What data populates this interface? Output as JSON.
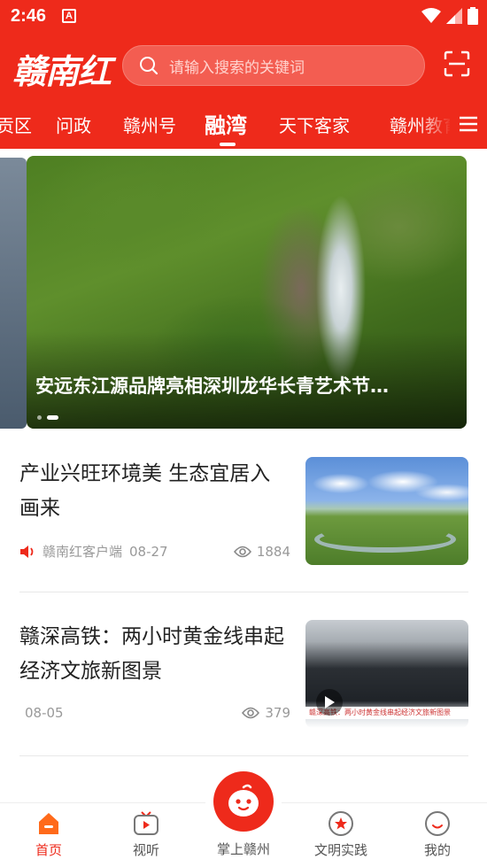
{
  "status_bar": {
    "time": "2:46",
    "notification_letter": "A"
  },
  "header": {
    "logo_text": "赣南红",
    "search_placeholder": "请输入搜索的关键词",
    "scan_icon": "scan-icon"
  },
  "tabs": {
    "items": [
      "贡区",
      "问政",
      "赣州号",
      "融湾",
      "天下客家",
      "赣州教育"
    ],
    "active": "融湾"
  },
  "banner": {
    "title": "安远东江源品牌亮相深圳龙华长青艺术节…",
    "slide_count": 2,
    "active_slide": 2
  },
  "news": [
    {
      "title": "产业兴旺环境美  生态宜居入画来",
      "source": "赣南红客户端",
      "date": "08-27",
      "views": "1884",
      "has_audio_icon": true,
      "is_video": false
    },
    {
      "title": "赣深高铁：两小时黄金线串起经济文旅新图景",
      "source": "",
      "date": "08-05",
      "views": "379",
      "has_audio_icon": false,
      "is_video": true,
      "thumb_caption": "赣深高铁：两小时黄金线串起经济文旅新图景"
    }
  ],
  "bottom_nav": {
    "items": [
      {
        "label": "首页",
        "icon": "home-icon",
        "active": true
      },
      {
        "label": "视听",
        "icon": "tv-icon",
        "active": false
      },
      {
        "label": "掌上赣州",
        "icon": "mascot-icon",
        "active": false
      },
      {
        "label": "文明实践",
        "icon": "star-badge-icon",
        "active": false
      },
      {
        "label": "我的",
        "icon": "profile-icon",
        "active": false
      }
    ]
  },
  "colors": {
    "brand_red": "#ee2a1b",
    "text_gray": "#999999"
  }
}
